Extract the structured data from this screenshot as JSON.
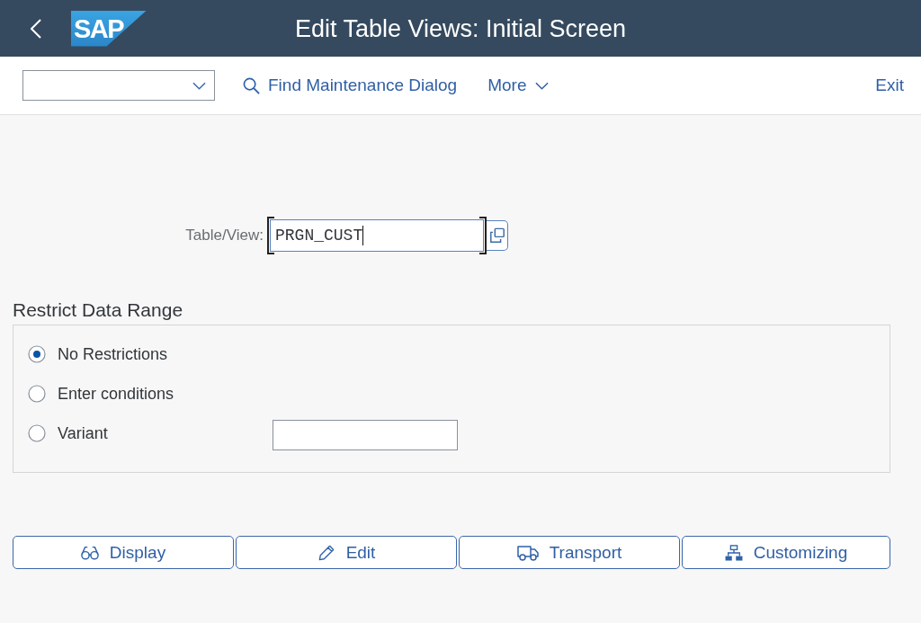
{
  "header": {
    "logo": "SAP",
    "title": "Edit Table Views: Initial Screen"
  },
  "toolbar": {
    "actions": [
      {
        "label": "Find Maintenance Dialog",
        "kind": "search"
      },
      {
        "label": "More",
        "kind": "menu"
      }
    ],
    "exit": "Exit"
  },
  "table_view": {
    "label": "Table/View:",
    "value": "PRGN_CUST",
    "focused": true
  },
  "restrict": {
    "title": "Restrict Data Range",
    "options": [
      {
        "label": "No Restrictions",
        "selected": true,
        "kind": "plain"
      },
      {
        "label": "Enter conditions",
        "selected": false,
        "kind": "plain"
      },
      {
        "label": "Variant",
        "selected": false,
        "kind": "input"
      }
    ]
  },
  "buttons": [
    {
      "label": "Display",
      "kind": "display"
    },
    {
      "label": "Edit",
      "kind": "edit"
    },
    {
      "label": "Transport",
      "kind": "transport"
    },
    {
      "label": "Customizing",
      "kind": "customizing"
    }
  ]
}
